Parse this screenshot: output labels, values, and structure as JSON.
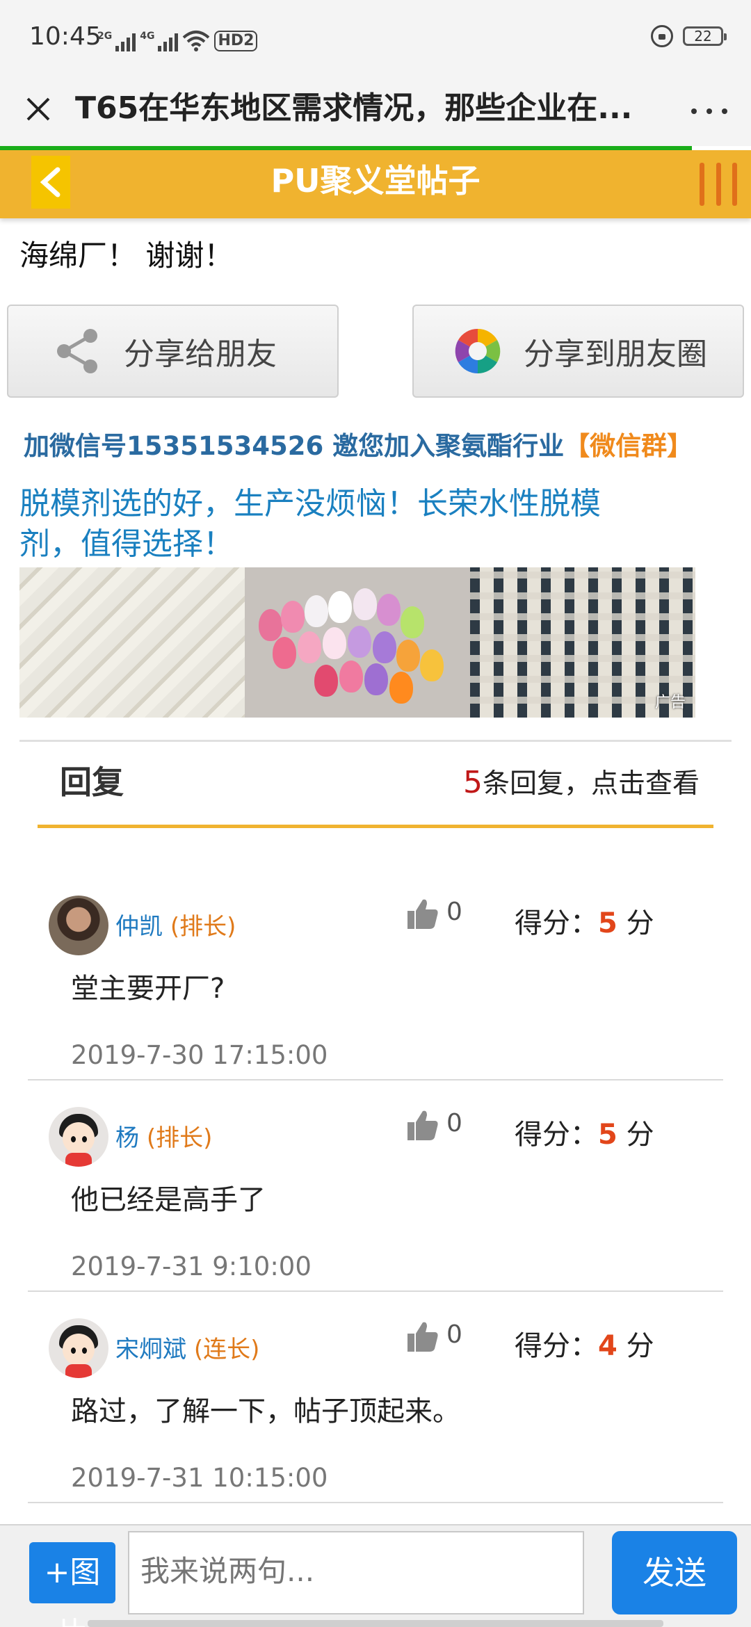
{
  "status_bar": {
    "time": "10:45",
    "net1": "2G",
    "net2": "4G",
    "hd": "HD2",
    "battery": "22"
  },
  "browser": {
    "title": "T65在华东地区需求情况，那些企业在..."
  },
  "header": {
    "title": "PU聚义堂帖子"
  },
  "post": {
    "text": "海绵厂！ 谢谢！"
  },
  "share": {
    "friend_label": "分享给朋友",
    "moments_label": "分享到朋友圈"
  },
  "wechat": {
    "prefix": "加微信号15351534526 邀您加入聚氨酯行业",
    "group": "【微信群】"
  },
  "ad": {
    "text": "脱模剂选的好，生产没烦恼！长荣水性脱模剂，值得选择！",
    "badge": "广告"
  },
  "replies_section": {
    "heading": "回复",
    "count": "5",
    "count_suffix": "条回复，点击查看"
  },
  "replies": [
    {
      "name": "仲凯",
      "rank": "(排长)",
      "likes": "0",
      "score_label": "得分：",
      "score": "5",
      "score_unit": "分",
      "text": "堂主要开厂?",
      "time": "2019-7-30 17:15:00"
    },
    {
      "name": "杨",
      "rank": "(排长)",
      "likes": "0",
      "score_label": "得分：",
      "score": "5",
      "score_unit": "分",
      "text": "他已经是高手了",
      "time": "2019-7-31 9:10:00"
    },
    {
      "name": "宋炯斌",
      "rank": "(连长)",
      "likes": "0",
      "score_label": "得分：",
      "score": "4",
      "score_unit": "分",
      "text": "路过，了解一下，帖子顶起来。",
      "time": "2019-7-31 10:15:00"
    }
  ],
  "bottom": {
    "image_button": "+图片",
    "input_placeholder": "我来说两句...",
    "send_button": "发送"
  },
  "colors": {
    "header_bg": "#f0b32f",
    "link_blue": "#1f7ac0",
    "rank_orange": "#e07a1a",
    "score_red": "#e2461a",
    "button_blue": "#1a82e6",
    "progress_green": "#1aad19"
  }
}
